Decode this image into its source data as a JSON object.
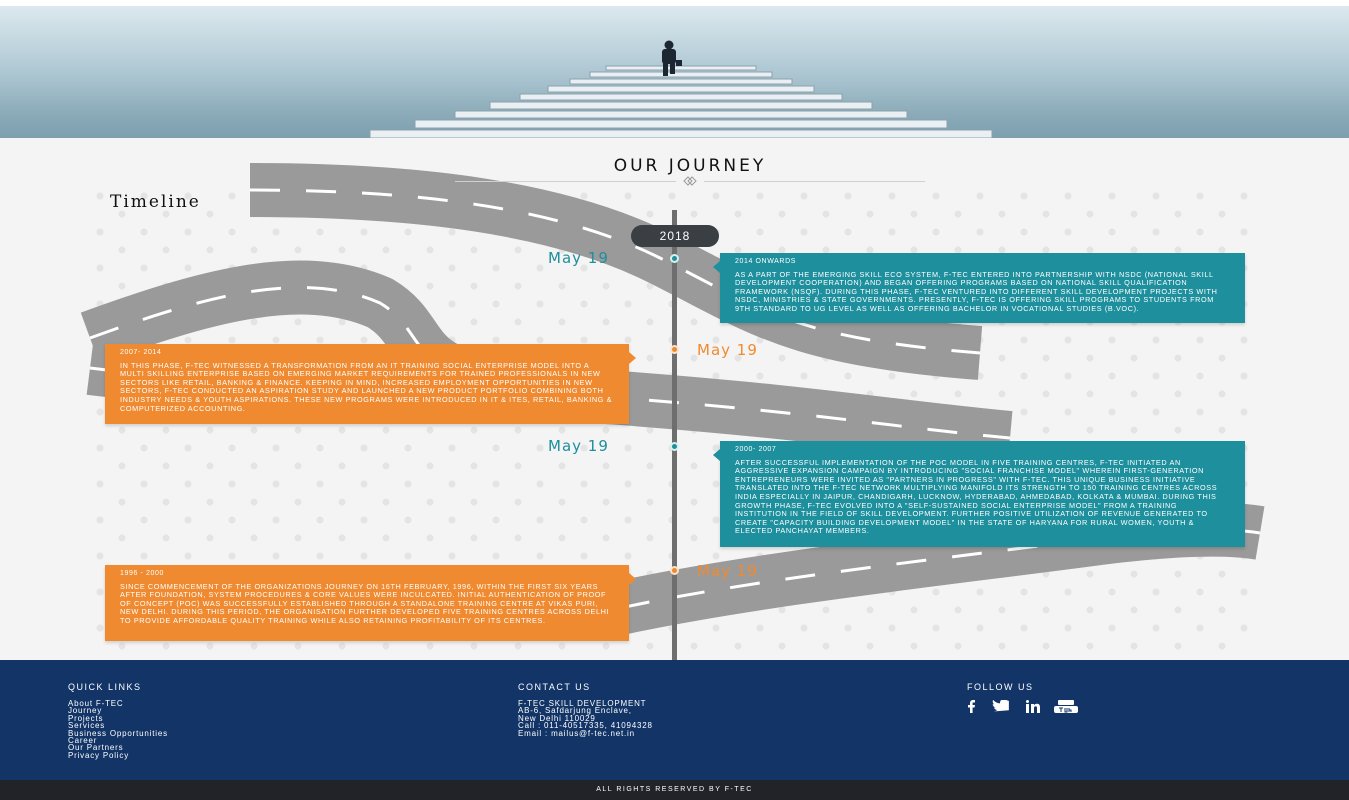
{
  "hero": {
    "alt": "man walking up staircase"
  },
  "journey": {
    "title": "OUR JOURNEY",
    "timeline_label": "Timeline",
    "year_badge": "2018"
  },
  "entries": [
    {
      "date": "May 19",
      "period": "2014 ONWARDS",
      "text": "AS A PART OF THE EMERGING SKILL ECO SYSTEM, F-TEC ENTERED INTO PARTNERSHIP WITH NSDC (NATIONAL SKILL DEVELOPMENT COOPERATION) AND BEGAN OFFERING PROGRAMS BASED ON NATIONAL SKILL QUALIFICATION FRAMEWORK (NSQF). DURING THIS PHASE, F-TEC VENTURED INTO DIFFERENT SKILL DEVELOPMENT PROJECTS WITH NSDC, MINISTRIES & STATE GOVERNMENTS. PRESENTLY, F-TEC IS OFFERING SKILL PROGRAMS TO STUDENTS FROM 9TH STANDARD TO UG LEVEL AS WELL AS OFFERING BACHELOR IN VOCATIONAL STUDIES (B.VOC)."
    },
    {
      "date": "May 19",
      "period": "2007- 2014",
      "text": "IN THIS PHASE, F-TEC WITNESSED A TRANSFORMATION FROM AN IT TRAINING SOCIAL ENTERPRISE MODEL INTO A MULTI SKILLING ENTERPRISE BASED ON EMERGING MARKET REQUIREMENTS FOR TRAINED PROFESSIONALS IN NEW SECTORS LIKE RETAIL, BANKING & FINANCE. KEEPING IN MIND, INCREASED EMPLOYMENT OPPORTUNITIES IN NEW SECTORS, F-TEC CONDUCTED AN ASPIRATION STUDY AND LAUNCHED A NEW PRODUCT PORTFOLIO COMBINING BOTH INDUSTRY NEEDS & YOUTH ASPIRATIONS. THESE NEW PROGRAMS WERE INTRODUCED IN IT & ITES, RETAIL, BANKING & COMPUTERIZED ACCOUNTING."
    },
    {
      "date": "May 19",
      "period": "2000- 2007",
      "text": "AFTER SUCCESSFUL IMPLEMENTATION OF THE POC MODEL IN FIVE TRAINING CENTRES, F-TEC INITIATED AN AGGRESSIVE EXPANSION CAMPAIGN BY INTRODUCING \"SOCIAL FRANCHISE MODEL\" WHEREIN FIRST-GENERATION ENTREPRENEURS WERE INVITED AS \"PARTNERS IN PROGRESS\" WITH F-TEC. THIS UNIQUE BUSINESS INITIATIVE TRANSLATED INTO THE F-TEC NETWORK MULTIPLYING MANIFOLD ITS STRENGTH TO 150 TRAINING CENTRES ACROSS INDIA ESPECIALLY IN JAIPUR, CHANDIGARH, LUCKNOW, HYDERABAD, AHMEDABAD, KOLKATA & MUMBAI. DURING THIS GROWTH PHASE, F-TEC EVOLVED INTO A \"SELF-SUSTAINED SOCIAL ENTERPRISE MODEL\" FROM A TRAINING INSTITUTION IN THE FIELD OF SKILL DEVELOPMENT. FURTHER POSITIVE UTILIZATION OF REVENUE GENERATED TO CREATE \"CAPACITY BUILDING DEVELOPMENT MODEL\" IN THE STATE OF HARYANA FOR RURAL WOMEN, YOUTH & ELECTED PANCHAYAT MEMBERS."
    },
    {
      "date": "May 19",
      "period": "1996 - 2000",
      "text": "SINCE COMMENCEMENT OF THE ORGANIZATIONS JOURNEY ON 16TH FEBRUARY, 1996, WITHIN THE FIRST SIX YEARS AFTER FOUNDATION, SYSTEM PROCEDURES & CORE VALUES WERE INCULCATED. INITIAL AUTHENTICATION OF PROOF OF CONCEPT (POC) WAS SUCCESSFULLY ESTABLISHED THROUGH A STANDALONE TRAINING CENTRE AT VIKAS PURI, NEW DELHI. DURING THIS PERIOD, THE ORGANISATION FURTHER DEVELOPED FIVE TRAINING CENTRES ACROSS DELHI TO PROVIDE AFFORDABLE QUALITY TRAINING WHILE ALSO RETAINING PROFITABILITY OF ITS CENTRES."
    }
  ],
  "footer": {
    "quick_links": {
      "heading": "QUICK LINKS",
      "items": [
        "About F-TEC",
        "Journey",
        "Projects",
        "Services",
        "Business Opportunities",
        "Career",
        "Our Partners",
        "Privacy Policy"
      ]
    },
    "contact": {
      "heading": "CONTACT US",
      "lines": [
        "F-TEC SKILL DEVELOPMENT",
        "AB-6, Safdarjung Enclave,",
        "New Delhi 110029",
        "Call : 011-40517335, 41094328",
        "Email : mailus@f-tec.net.in"
      ]
    },
    "follow": {
      "heading": "FOLLOW US",
      "icons": [
        "facebook-icon",
        "twitter-icon",
        "linkedin-icon",
        "youtube-icon"
      ]
    },
    "copyright": "ALL RIGHTS RESERVED BY F-TEC"
  },
  "colors": {
    "teal": "#1e8f9c",
    "orange": "#f08a30",
    "footer": "#123466",
    "bottom_bar": "#222329"
  }
}
